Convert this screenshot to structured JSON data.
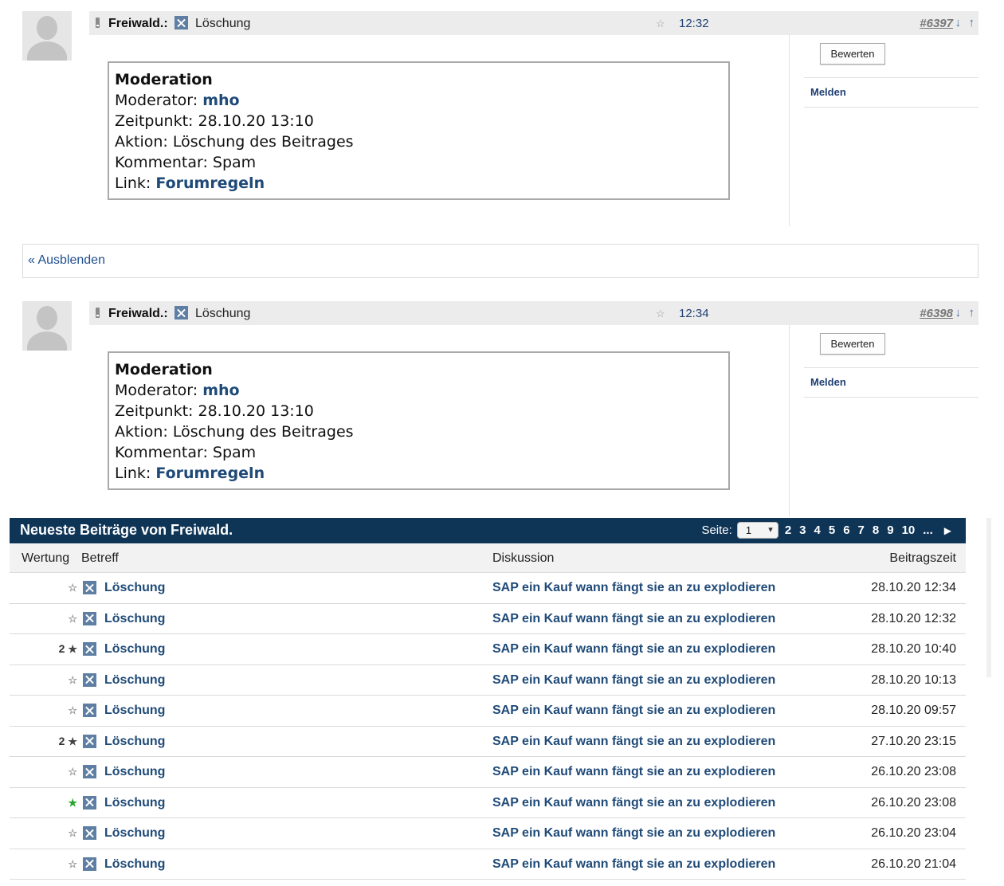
{
  "posts": [
    {
      "author": "Freiwald.:",
      "title": "Löschung",
      "time": "12:32",
      "number": "#6397",
      "rate_button": "Bewerten",
      "report_link": "Melden",
      "moderation": {
        "heading": "Moderation",
        "moderator_label": "Moderator: ",
        "moderator": "mho",
        "time_label": "Zeitpunkt: ",
        "time": "28.10.20 13:10",
        "action_label": "Aktion: ",
        "action": "Löschung des Beitrages",
        "comment_label": "Kommentar: ",
        "comment": "Spam",
        "link_label": "Link: ",
        "link": "Forumregeln"
      }
    },
    {
      "author": "Freiwald.:",
      "title": "Löschung",
      "time": "12:34",
      "number": "#6398",
      "rate_button": "Bewerten",
      "report_link": "Melden",
      "moderation": {
        "heading": "Moderation",
        "moderator_label": "Moderator: ",
        "moderator": "mho",
        "time_label": "Zeitpunkt: ",
        "time": "28.10.20 13:10",
        "action_label": "Aktion: ",
        "action": "Löschung des Beitrages",
        "comment_label": "Kommentar: ",
        "comment": "Spam",
        "link_label": "Link: ",
        "link": "Forumregeln"
      }
    }
  ],
  "hide_link": "« Ausblenden",
  "recent": {
    "title": "Neueste Beiträge von Freiwald.",
    "page_label": "Seite:",
    "page_selected": "1",
    "pages": [
      "2",
      "3",
      "4",
      "5",
      "6",
      "7",
      "8",
      "9",
      "10",
      "..."
    ],
    "columns": {
      "rating": "Wertung",
      "subject": "Betreff",
      "discussion": "Diskussion",
      "time": "Beitragszeit"
    },
    "rows": [
      {
        "rating": "",
        "rating_state": "none",
        "subject": "Löschung",
        "discussion": "SAP ein Kauf wann fängt sie an zu explodieren",
        "time": "28.10.20 12:34"
      },
      {
        "rating": "",
        "rating_state": "none",
        "subject": "Löschung",
        "discussion": "SAP ein Kauf wann fängt sie an zu explodieren",
        "time": "28.10.20 12:32"
      },
      {
        "rating": "2",
        "rating_state": "rated",
        "subject": "Löschung",
        "discussion": "SAP ein Kauf wann fängt sie an zu explodieren",
        "time": "28.10.20 10:40"
      },
      {
        "rating": "",
        "rating_state": "none",
        "subject": "Löschung",
        "discussion": "SAP ein Kauf wann fängt sie an zu explodieren",
        "time": "28.10.20 10:13"
      },
      {
        "rating": "",
        "rating_state": "none",
        "subject": "Löschung",
        "discussion": "SAP ein Kauf wann fängt sie an zu explodieren",
        "time": "28.10.20 09:57"
      },
      {
        "rating": "2",
        "rating_state": "rated",
        "subject": "Löschung",
        "discussion": "SAP ein Kauf wann fängt sie an zu explodieren",
        "time": "27.10.20 23:15"
      },
      {
        "rating": "",
        "rating_state": "none",
        "subject": "Löschung",
        "discussion": "SAP ein Kauf wann fängt sie an zu explodieren",
        "time": "26.10.20 23:08"
      },
      {
        "rating": "",
        "rating_state": "good",
        "subject": "Löschung",
        "discussion": "SAP ein Kauf wann fängt sie an zu explodieren",
        "time": "26.10.20 23:08"
      },
      {
        "rating": "",
        "rating_state": "none",
        "subject": "Löschung",
        "discussion": "SAP ein Kauf wann fängt sie an zu explodieren",
        "time": "26.10.20 23:04"
      },
      {
        "rating": "",
        "rating_state": "none",
        "subject": "Löschung",
        "discussion": "SAP ein Kauf wann fängt sie an zu explodieren",
        "time": "26.10.20 21:04"
      }
    ]
  },
  "colors": {
    "header_bar": "#0e3456",
    "link_blue": "#1f4a78",
    "post_header_bg": "#ececec",
    "good_star": "#2aa52a"
  },
  "icons": {
    "avatar": "default-avatar-icon",
    "phone": "mobile-phone-icon",
    "post_type": "deleted-post-x-icon",
    "rating": "star-icon",
    "next_page": "triangle-right-icon"
  }
}
